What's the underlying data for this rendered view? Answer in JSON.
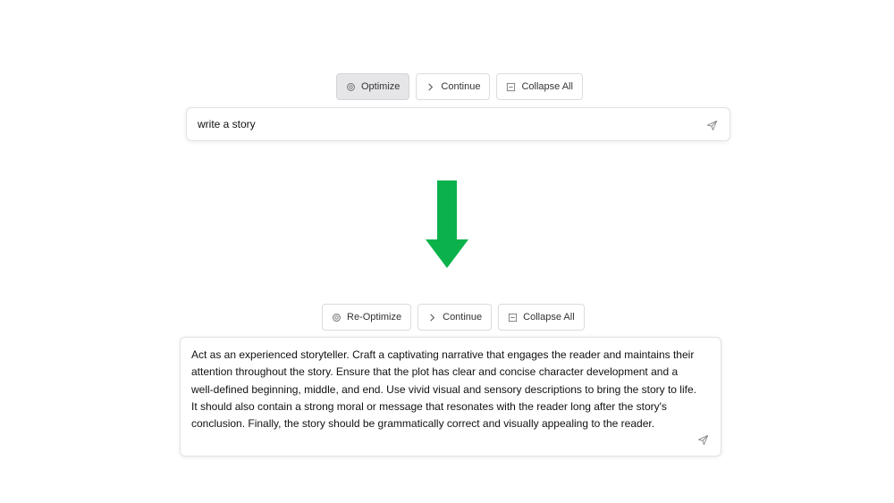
{
  "toolbar_top": {
    "optimize_label": "Optimize",
    "continue_label": "Continue",
    "collapse_label": "Collapse All"
  },
  "prompt_top": {
    "value": "write a story"
  },
  "toolbar_bottom": {
    "reoptimize_label": "Re-Optimize",
    "continue_label": "Continue",
    "collapse_label": "Collapse All"
  },
  "prompt_bottom": {
    "value": "Act as an experienced storyteller. Craft a captivating narrative that engages the reader and maintains their attention throughout the story. Ensure that the plot has clear and concise character development and a well-defined beginning, middle, and end. Use vivid visual and sensory descriptions to bring the story to life. It should also contain a strong moral or message that resonates with the reader long after the story's conclusion. Finally, the story should be grammatically correct and visually appealing to the reader."
  },
  "icons": {
    "optimize": "sparkle-icon",
    "continue": "chevron-right-icon",
    "collapse": "collapse-icon",
    "send": "send-icon",
    "arrow": "arrow-down-icon"
  },
  "colors": {
    "arrow": "#0bb24c",
    "active_button_bg": "#e6e6e9",
    "border": "#dcdcdc"
  }
}
